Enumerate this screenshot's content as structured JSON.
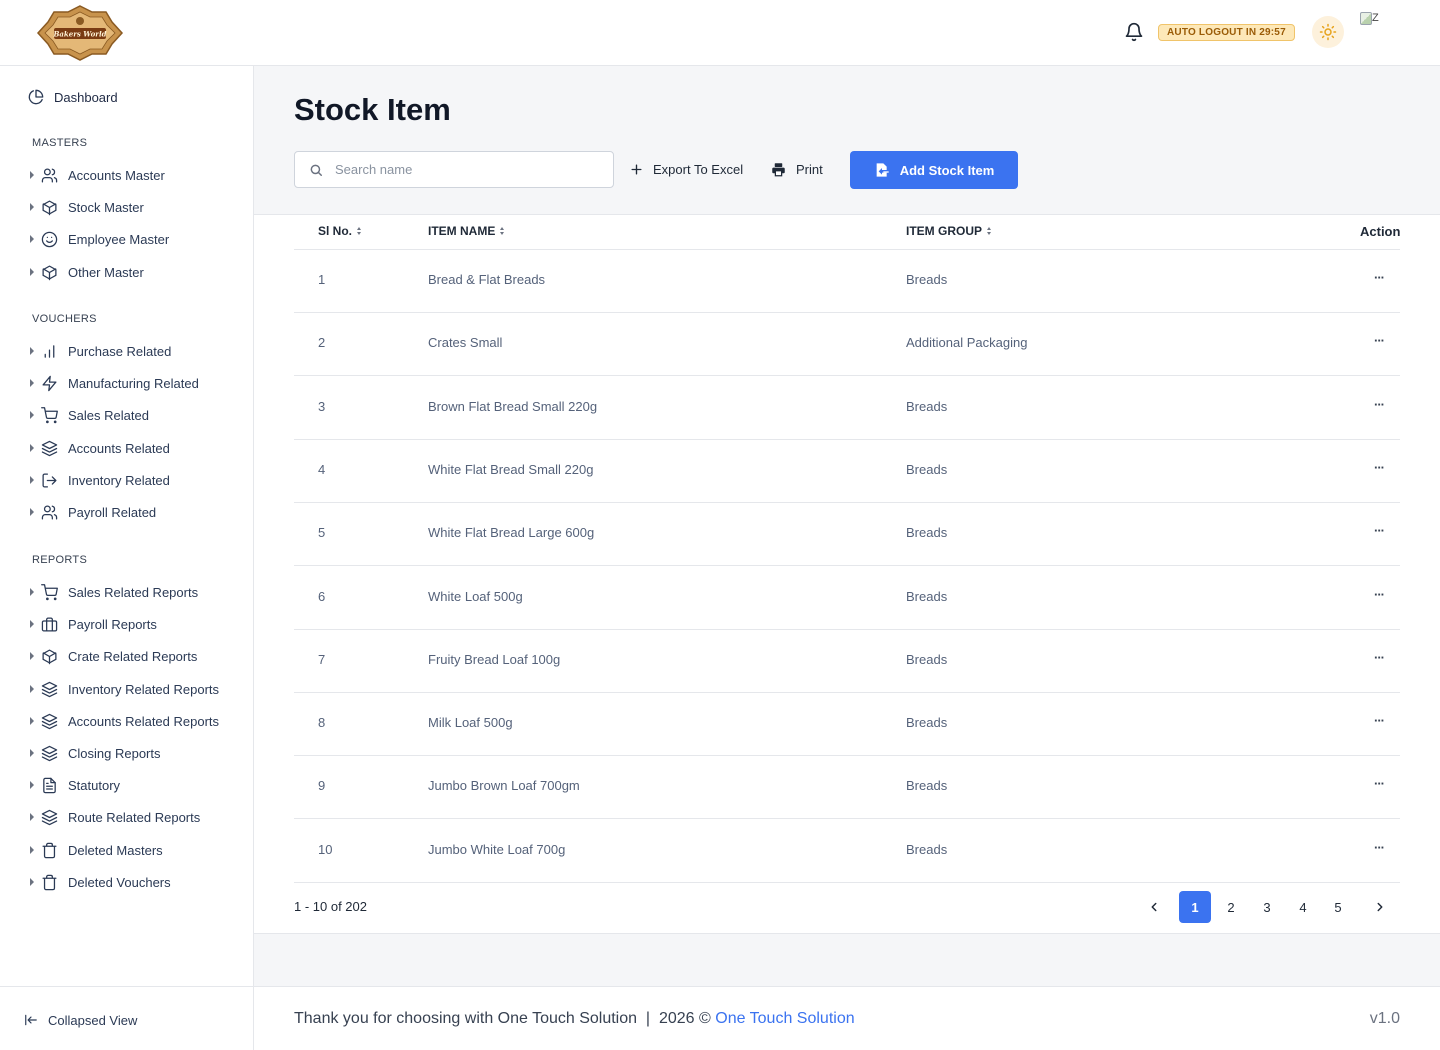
{
  "header": {
    "logo_text": "Bakers World",
    "auto_logout": "AUTO LOGOUT IN 29:57",
    "avatar_alt": "Z"
  },
  "sidebar": {
    "dashboard": "Dashboard",
    "sections": {
      "masters": "MASTERS",
      "vouchers": "VOUCHERS",
      "reports": "REPORTS"
    },
    "masters": [
      {
        "label": "Accounts Master",
        "icon": "users-icon"
      },
      {
        "label": "Stock Master",
        "icon": "box-icon"
      },
      {
        "label": "Employee Master",
        "icon": "smile-icon"
      },
      {
        "label": "Other Master",
        "icon": "box-icon"
      }
    ],
    "vouchers": [
      {
        "label": "Purchase Related",
        "icon": "bar-chart-icon"
      },
      {
        "label": "Manufacturing Related",
        "icon": "zap-icon"
      },
      {
        "label": "Sales Related",
        "icon": "cart-icon"
      },
      {
        "label": "Accounts Related",
        "icon": "layers-icon"
      },
      {
        "label": "Inventory Related",
        "icon": "log-out-icon"
      },
      {
        "label": "Payroll Related",
        "icon": "users-icon"
      }
    ],
    "reports": [
      {
        "label": "Sales Related Reports",
        "icon": "cart-icon"
      },
      {
        "label": "Payroll Reports",
        "icon": "briefcase-icon"
      },
      {
        "label": "Crate Related Reports",
        "icon": "box-icon"
      },
      {
        "label": "Inventory Related Reports",
        "icon": "layers-icon"
      },
      {
        "label": "Accounts Related Reports",
        "icon": "layers-icon"
      },
      {
        "label": "Closing Reports",
        "icon": "layers-icon"
      },
      {
        "label": "Statutory",
        "icon": "file-icon"
      },
      {
        "label": "Route Related Reports",
        "icon": "layers-icon"
      },
      {
        "label": "Deleted Masters",
        "icon": "trash-icon"
      },
      {
        "label": "Deleted Vouchers",
        "icon": "trash-icon"
      }
    ],
    "collapse": "Collapsed View"
  },
  "main": {
    "title": "Stock Item",
    "search_placeholder": "Search name",
    "export_label": "Export To Excel",
    "print_label": "Print",
    "add_label": "Add Stock Item"
  },
  "table": {
    "columns": {
      "sl": "Sl No.",
      "name": "ITEM NAME",
      "group": "ITEM GROUP",
      "action": "Action"
    },
    "rows": [
      {
        "sl": "1",
        "name": "Bread & Flat Breads",
        "group": "Breads",
        "action": "···"
      },
      {
        "sl": "2",
        "name": "Crates Small",
        "group": "Additional Packaging",
        "action": "···"
      },
      {
        "sl": "3",
        "name": "Brown Flat Bread Small 220g",
        "group": "Breads",
        "action": "···"
      },
      {
        "sl": "4",
        "name": "White Flat Bread Small 220g",
        "group": "Breads",
        "action": "···"
      },
      {
        "sl": "5",
        "name": "White Flat Bread Large 600g",
        "group": "Breads",
        "action": "···"
      },
      {
        "sl": "6",
        "name": "White Loaf 500g",
        "group": "Breads",
        "action": "···"
      },
      {
        "sl": "7",
        "name": "Fruity Bread Loaf 100g",
        "group": "Breads",
        "action": "···"
      },
      {
        "sl": "8",
        "name": "Milk Loaf 500g",
        "group": "Breads",
        "action": "···"
      },
      {
        "sl": "9",
        "name": "Jumbo Brown Loaf 700gm",
        "group": "Breads",
        "action": "···"
      },
      {
        "sl": "10",
        "name": "Jumbo White Loaf 700g",
        "group": "Breads",
        "action": "···"
      }
    ]
  },
  "pagination": {
    "range": "1 - 10 of 202",
    "pages": [
      "1",
      "2",
      "3",
      "4",
      "5"
    ],
    "current": "1"
  },
  "footer": {
    "thanks": "Thank you for choosing with One Touch Solution  |  2026 ©",
    "link": "One Touch Solution",
    "version": "v1.0"
  },
  "colors": {
    "primary": "#3b73f0",
    "badge_bg": "#fde8b8",
    "badge_text": "#9a5b06"
  }
}
